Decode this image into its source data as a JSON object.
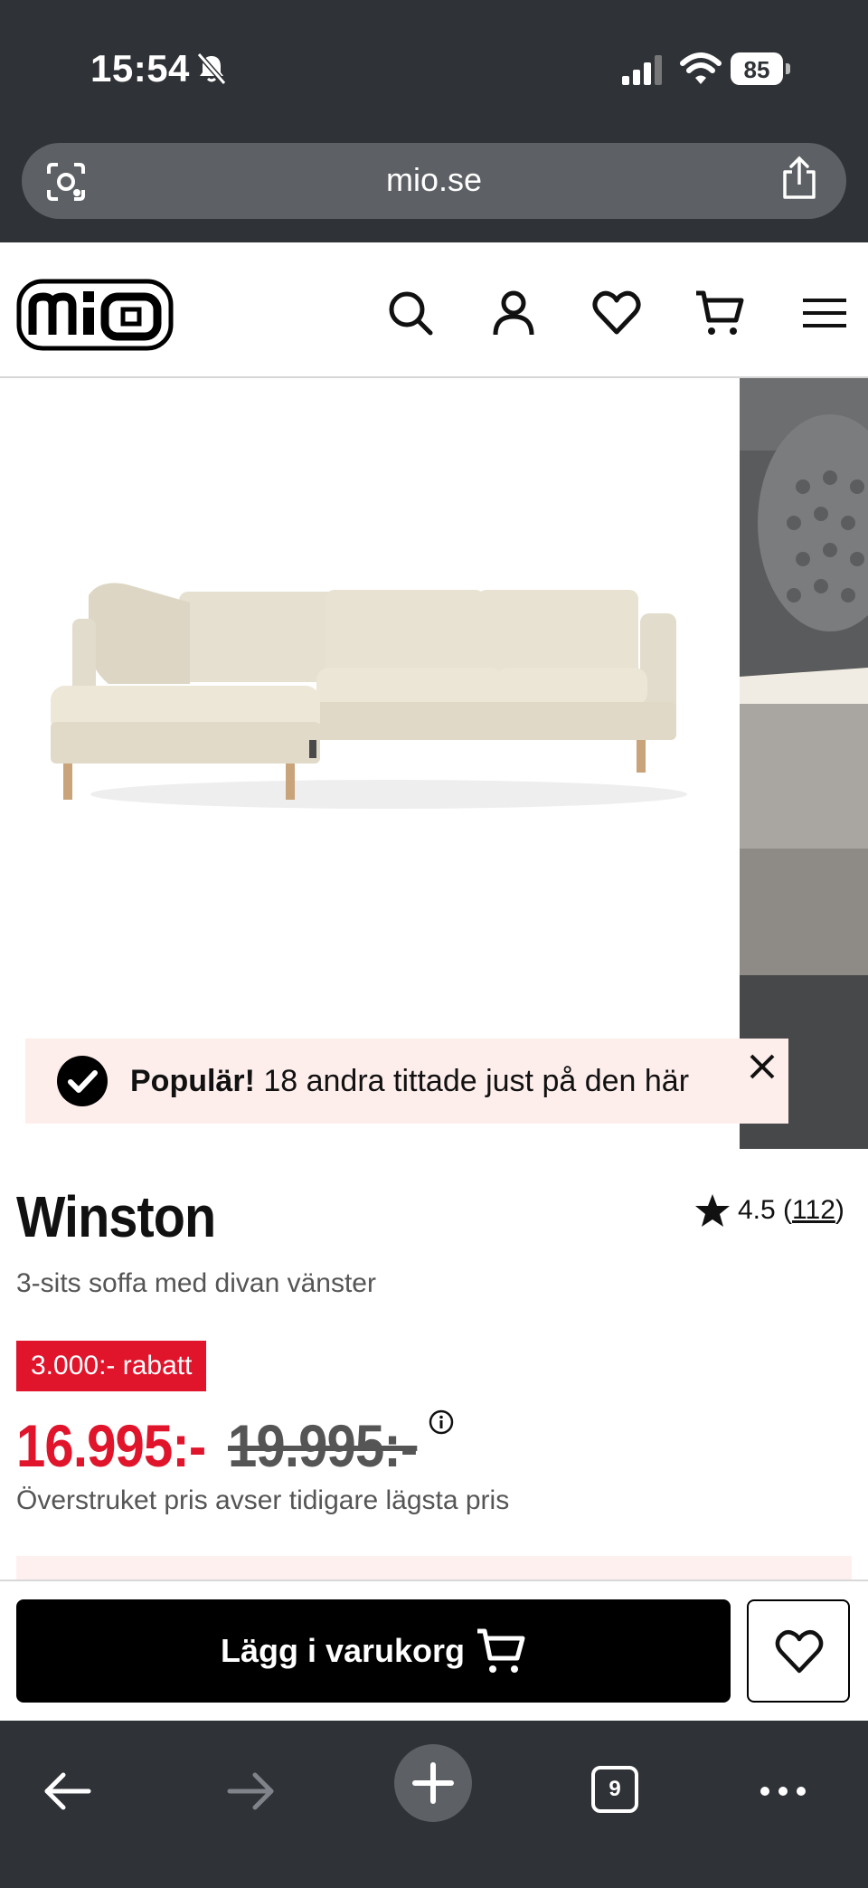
{
  "status_bar": {
    "time": "15:54",
    "battery": "85"
  },
  "browser": {
    "url": "mio.se",
    "tab_count": "9"
  },
  "site": {
    "logo_text": "mio",
    "header_icons": [
      "search-icon",
      "account-icon",
      "heart-icon",
      "cart-icon",
      "menu-icon"
    ]
  },
  "toast": {
    "bold": "Populär!",
    "text": " 18 andra tittade just på den här"
  },
  "product": {
    "title": "Winston",
    "subtitle": "3-sits soffa med divan vänster",
    "rating": "4.5",
    "review_count": "112",
    "discount_badge": "3.000:- rabatt",
    "price_now": "16.995:-",
    "price_old": "19.995:-",
    "price_note": "Överstruket pris avser tidigare lägsta pris"
  },
  "cart": {
    "add_label": "Lägg i varukorg"
  },
  "colors": {
    "sale_red": "#e0142b",
    "toast_bg": "#fdeeec",
    "chrome": "#2f3236"
  }
}
